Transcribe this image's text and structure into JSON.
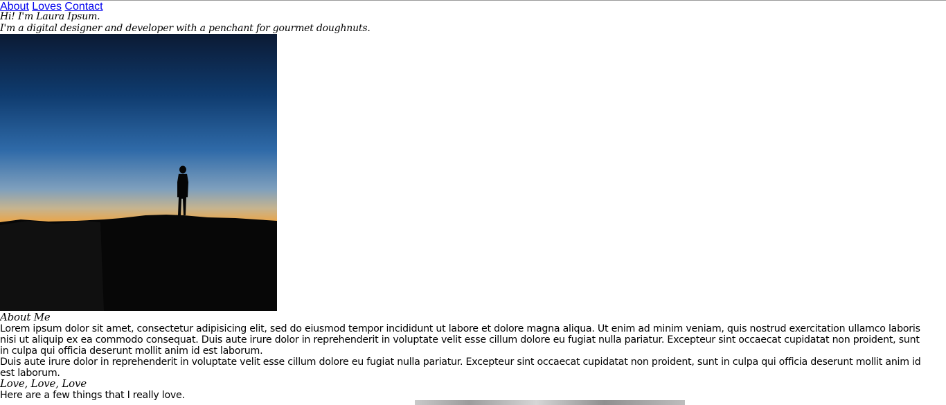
{
  "nav": {
    "items": [
      "About",
      "Loves",
      "Contact"
    ]
  },
  "header": {
    "greeting": "Hi! I'm Laura Ipsum.",
    "tagline": "I'm a digital designer and developer with a penchant for gourmet doughnuts."
  },
  "about": {
    "title": "About Me",
    "paragraphs": [
      "Lorem ipsum dolor sit amet, consectetur adipisicing elit, sed do eiusmod tempor incididunt ut labore et dolore magna aliqua. Ut enim ad minim veniam, quis nostrud exercitation ullamco laboris nisi ut aliquip ex ea commodo consequat. Duis aute irure dolor in reprehenderit in voluptate velit esse cillum dolore eu fugiat nulla pariatur. Excepteur sint occaecat cupidatat non proident, sunt in culpa qui officia deserunt mollit anim id est laborum.",
      "Duis aute irure dolor in reprehenderit in voluptate velit esse cillum dolore eu fugiat nulla pariatur. Excepteur sint occaecat cupidatat non proident, sunt in culpa qui officia deserunt mollit anim id est laborum."
    ]
  },
  "loves": {
    "title": "Love, Love, Love",
    "intro": "Here are a few things that I really love."
  },
  "colors": {
    "link": "#0000ee",
    "text": "#000000",
    "background": "#ffffff"
  }
}
